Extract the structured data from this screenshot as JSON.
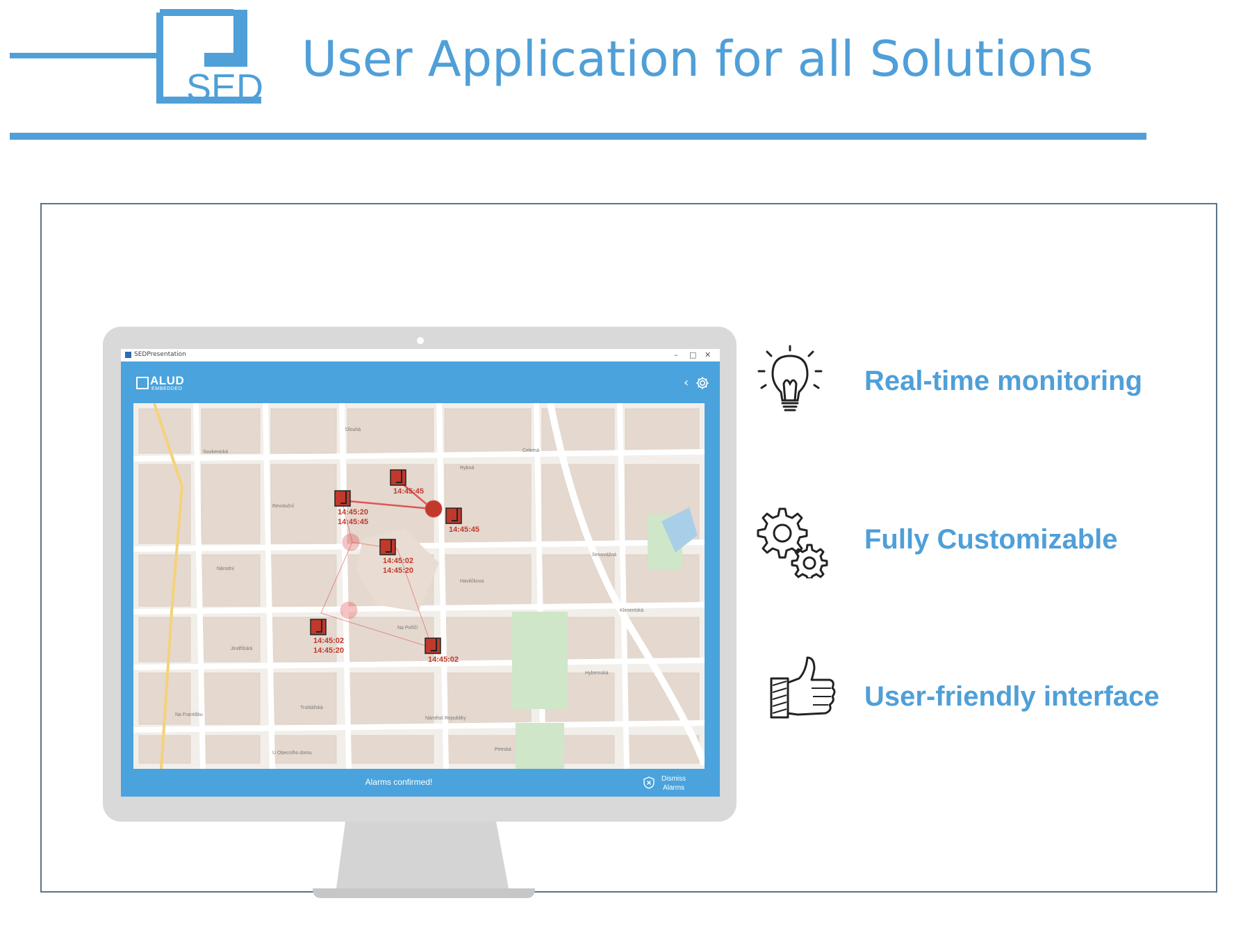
{
  "header": {
    "title": "User Application for all Solutions",
    "logo_text": "SED",
    "logo_mark": "J",
    "accent_color": "#4f9fd8"
  },
  "app": {
    "window_title": "SEDPresentation",
    "window_controls": [
      "–",
      "□",
      "✕"
    ],
    "brand_main": "ALUD",
    "brand_sub": "EMBEDDED",
    "status_message": "Alarms confirmed!",
    "dismiss_label_line1": "Dismiss",
    "dismiss_label_line2": "Alarms",
    "icons": [
      "back-icon",
      "gear-icon",
      "shield-x-icon"
    ]
  },
  "map": {
    "markers": [
      {
        "times": [
          "14:45:45"
        ]
      },
      {
        "times": [
          "14:45:20",
          "14:45:45"
        ]
      },
      {
        "times": [
          "14:45:45"
        ]
      },
      {
        "times": [
          "14:45:02",
          "14:45:20"
        ]
      },
      {
        "times": [
          "14:45:02",
          "14:45:20"
        ]
      },
      {
        "times": [
          "14:45:02"
        ]
      }
    ],
    "street_labels": [
      "Soukenická",
      "Revoluční",
      "Dlouhá",
      "Rybná",
      "Celetná",
      "Národní",
      "Na Poříčí",
      "Havlíčkova",
      "Senovážná",
      "Jindřišská",
      "Hybernská",
      "Náměstí Republiky",
      "Truhlářská",
      "Petrská",
      "Klimentská",
      "Na Františku",
      "U Obecního domu"
    ],
    "colors": {
      "alarm": "#c0392b",
      "track": "#e05555",
      "map_bg": "#f2efea",
      "building": "#e4d8cf",
      "park": "#cfe6c9",
      "water": "#a9cfe8"
    }
  },
  "features": [
    {
      "label": "Real-time monitoring",
      "icon": "lightbulb-icon"
    },
    {
      "label": "Fully Customizable",
      "icon": "gears-icon"
    },
    {
      "label": "User-friendly interface",
      "icon": "thumbs-up-icon"
    }
  ]
}
